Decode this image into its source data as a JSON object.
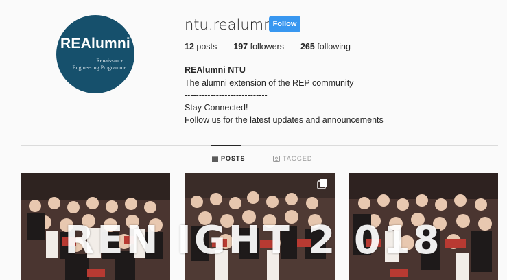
{
  "profile": {
    "avatar_brand": "REAlumni",
    "avatar_sub1": "Renaissance",
    "avatar_sub2": "Engineering Programme",
    "username": "ntu.realumni",
    "follow_label": "Follow",
    "posts_count": "12",
    "posts_label": "posts",
    "followers_count": "197",
    "followers_label": "followers",
    "following_count": "265",
    "following_label": "following",
    "full_name": "REAlumni NTU",
    "bio": "The alumni extension of the REP community\n-----------------------------\nStay Connected!\nFollow us for the latest updates and announcements"
  },
  "tabs": {
    "posts_label": "POSTS",
    "tagged_label": "TAGGED"
  },
  "overlay": {
    "text": "REN  IGHT 2  018"
  },
  "colors": {
    "follow_button": "#3897f0",
    "avatar_bg": "#16506c",
    "background": "#fafafa"
  }
}
